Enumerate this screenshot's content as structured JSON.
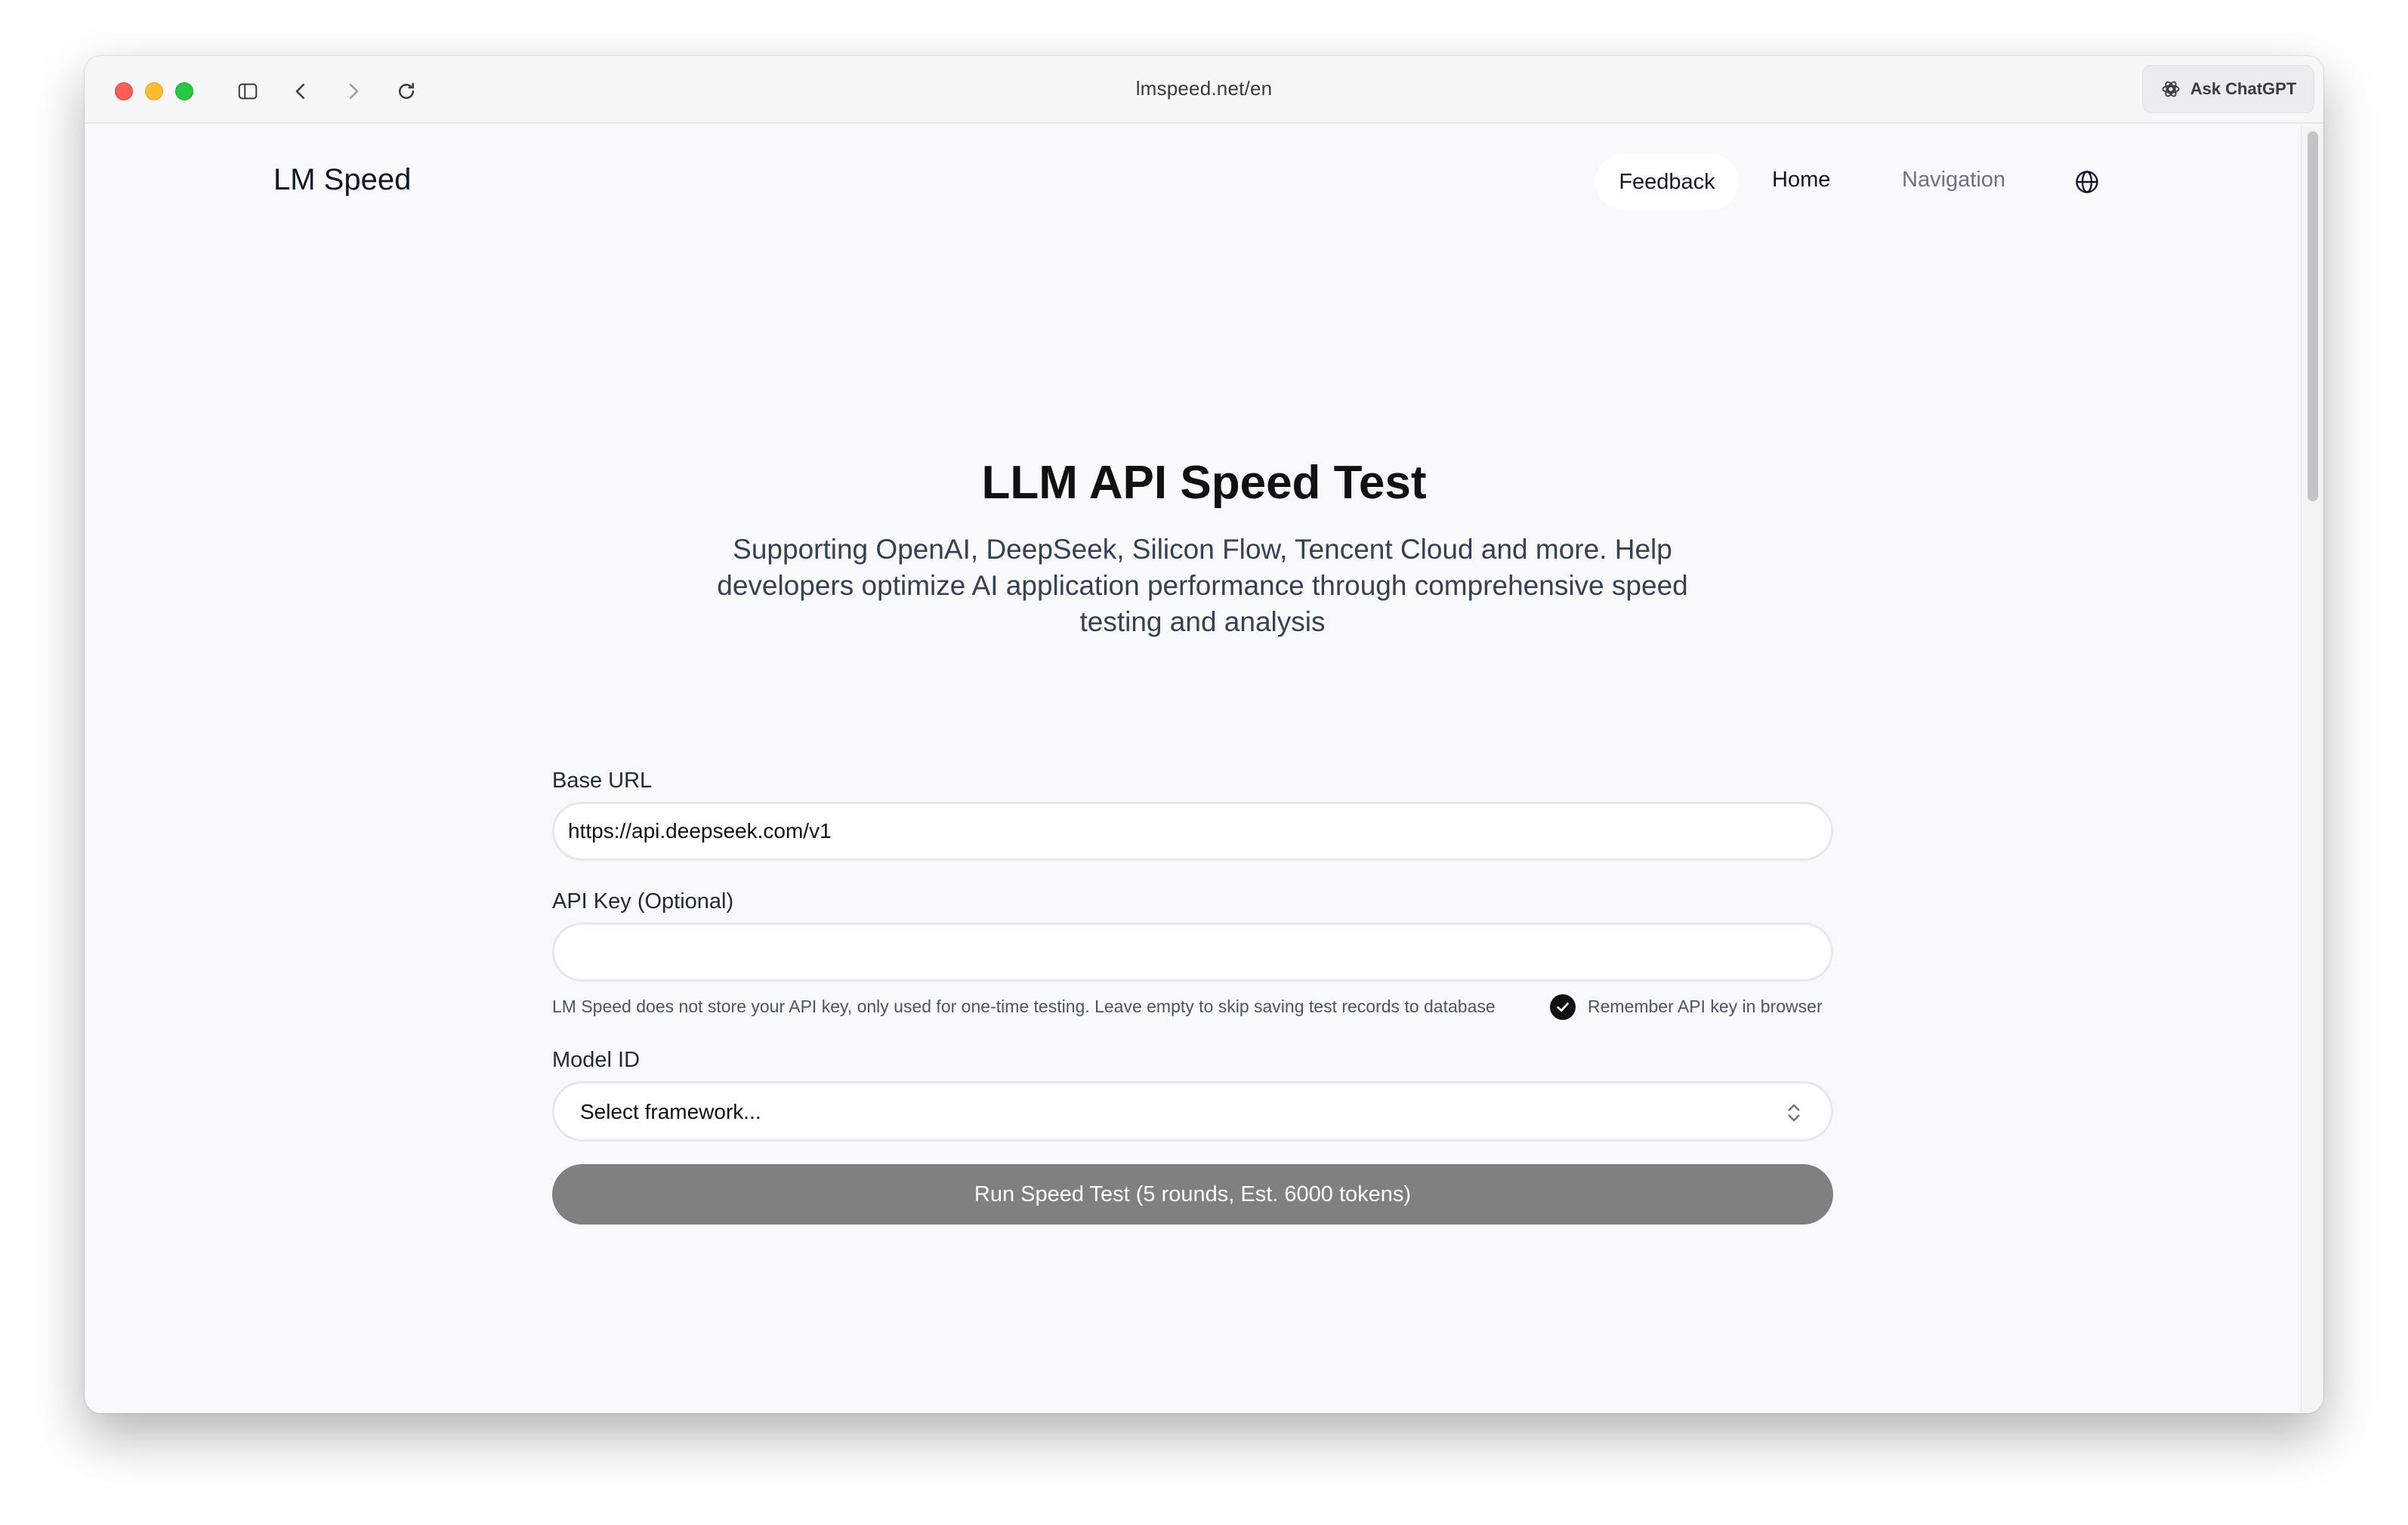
{
  "browser": {
    "url": "lmspeed.net/en",
    "ask_button_label": "Ask ChatGPT"
  },
  "site": {
    "logo": "LM Speed",
    "nav": {
      "feedback": "Feedback",
      "home": "Home",
      "navigation": "Navigation"
    }
  },
  "hero": {
    "title": "LLM API Speed Test",
    "subtitle": "Supporting OpenAI, DeepSeek, Silicon Flow, Tencent Cloud and more. Help developers optimize AI application performance through comprehensive speed testing and analysis"
  },
  "form": {
    "base_url_label": "Base URL",
    "base_url_value": "https://api.deepseek.com/v1",
    "api_key_label": "API Key (Optional)",
    "api_key_value": "",
    "api_key_note": "LM Speed does not store your API key, only used for one-time testing. Leave empty to skip saving test records to database",
    "remember_label": "Remember API key in browser",
    "remember_checked": true,
    "model_label": "Model ID",
    "model_placeholder": "Select framework...",
    "run_button": "Run Speed Test (5 rounds, Est. 6000 tokens)"
  },
  "colors": {
    "page_bg": "#f8f9fb",
    "run_button_bg": "#808080",
    "checkbox": "#111111"
  }
}
